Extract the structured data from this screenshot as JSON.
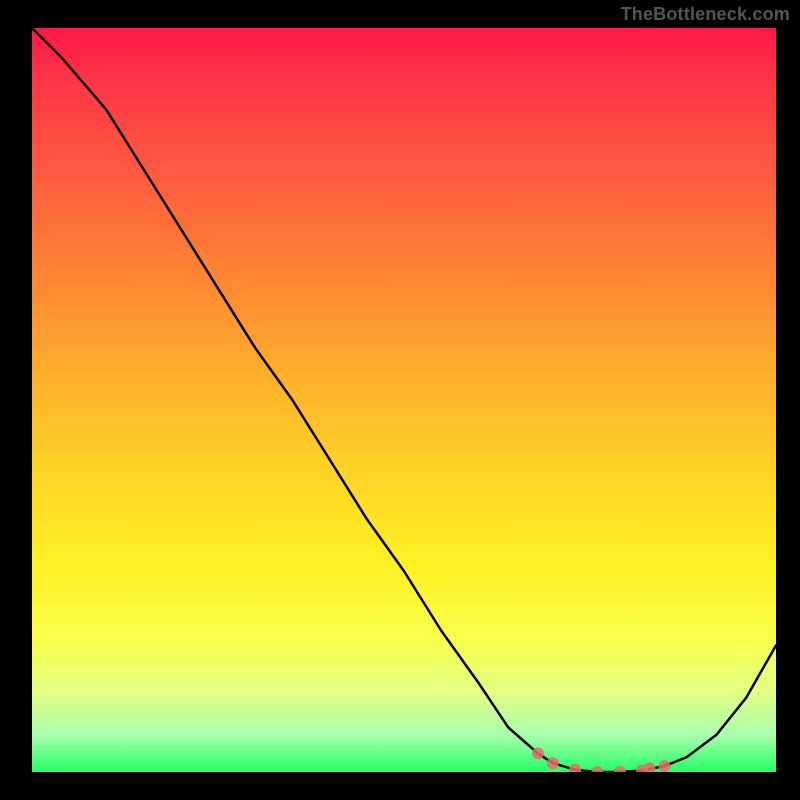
{
  "watermark": "TheBottleneck.com",
  "chart_data": {
    "type": "line",
    "title": "",
    "xlabel": "",
    "ylabel": "",
    "xlim": [
      0,
      100
    ],
    "ylim": [
      0,
      100
    ],
    "x": [
      0,
      4,
      10,
      15,
      20,
      25,
      30,
      35,
      40,
      45,
      50,
      55,
      60,
      64,
      68,
      70,
      73,
      76,
      79,
      82,
      85,
      88,
      92,
      96,
      100
    ],
    "values": [
      100,
      96,
      89,
      81,
      73,
      65,
      57,
      50,
      42,
      34,
      27,
      19,
      12,
      6,
      2.5,
      1.2,
      0.3,
      0,
      0,
      0.2,
      0.8,
      2,
      5,
      10,
      17
    ],
    "markers": {
      "x": [
        68,
        70,
        73,
        76,
        79,
        82,
        83,
        85
      ],
      "y": [
        2.5,
        1.2,
        0.3,
        0,
        0,
        0.2,
        0.5,
        0.8
      ]
    },
    "gradient_colors": [
      "#ff1749",
      "#ff8433",
      "#fff122",
      "#22ff66"
    ]
  }
}
